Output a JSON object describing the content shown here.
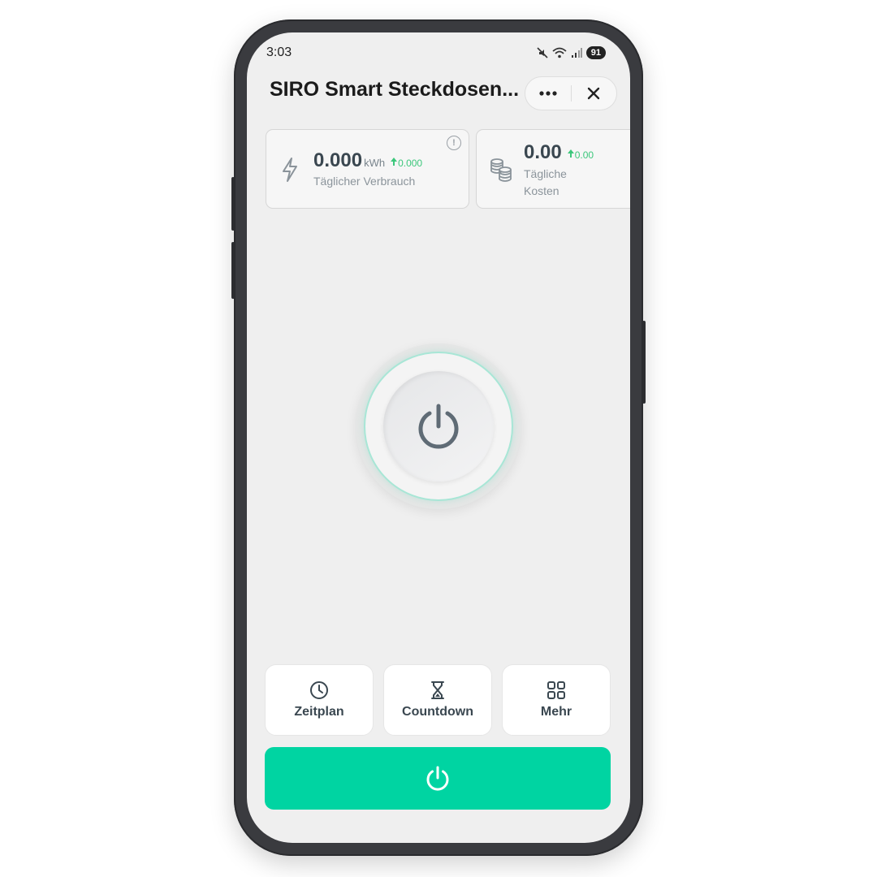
{
  "status_bar": {
    "time": "3:03",
    "battery": "91"
  },
  "header": {
    "title": "SIRO Smart Steckdosen..."
  },
  "stats": [
    {
      "value": "0.000",
      "unit": "kWh",
      "delta": "0.000",
      "label": "Täglicher Verbrauch",
      "icon": "lightning-icon"
    },
    {
      "value": "0.00",
      "delta": "0.00",
      "label_line1": "Tägliche",
      "label_line2": "Kosten",
      "icon": "coins-icon"
    }
  ],
  "actions": [
    {
      "label": "Zeitplan",
      "icon": "clock-icon"
    },
    {
      "label": "Countdown",
      "icon": "hourglass-icon"
    },
    {
      "label": "Mehr",
      "icon": "grid-icon"
    }
  ],
  "colors": {
    "accent": "#00d4a2",
    "delta_green": "#3cc77b",
    "text_dark": "#3a4750"
  }
}
